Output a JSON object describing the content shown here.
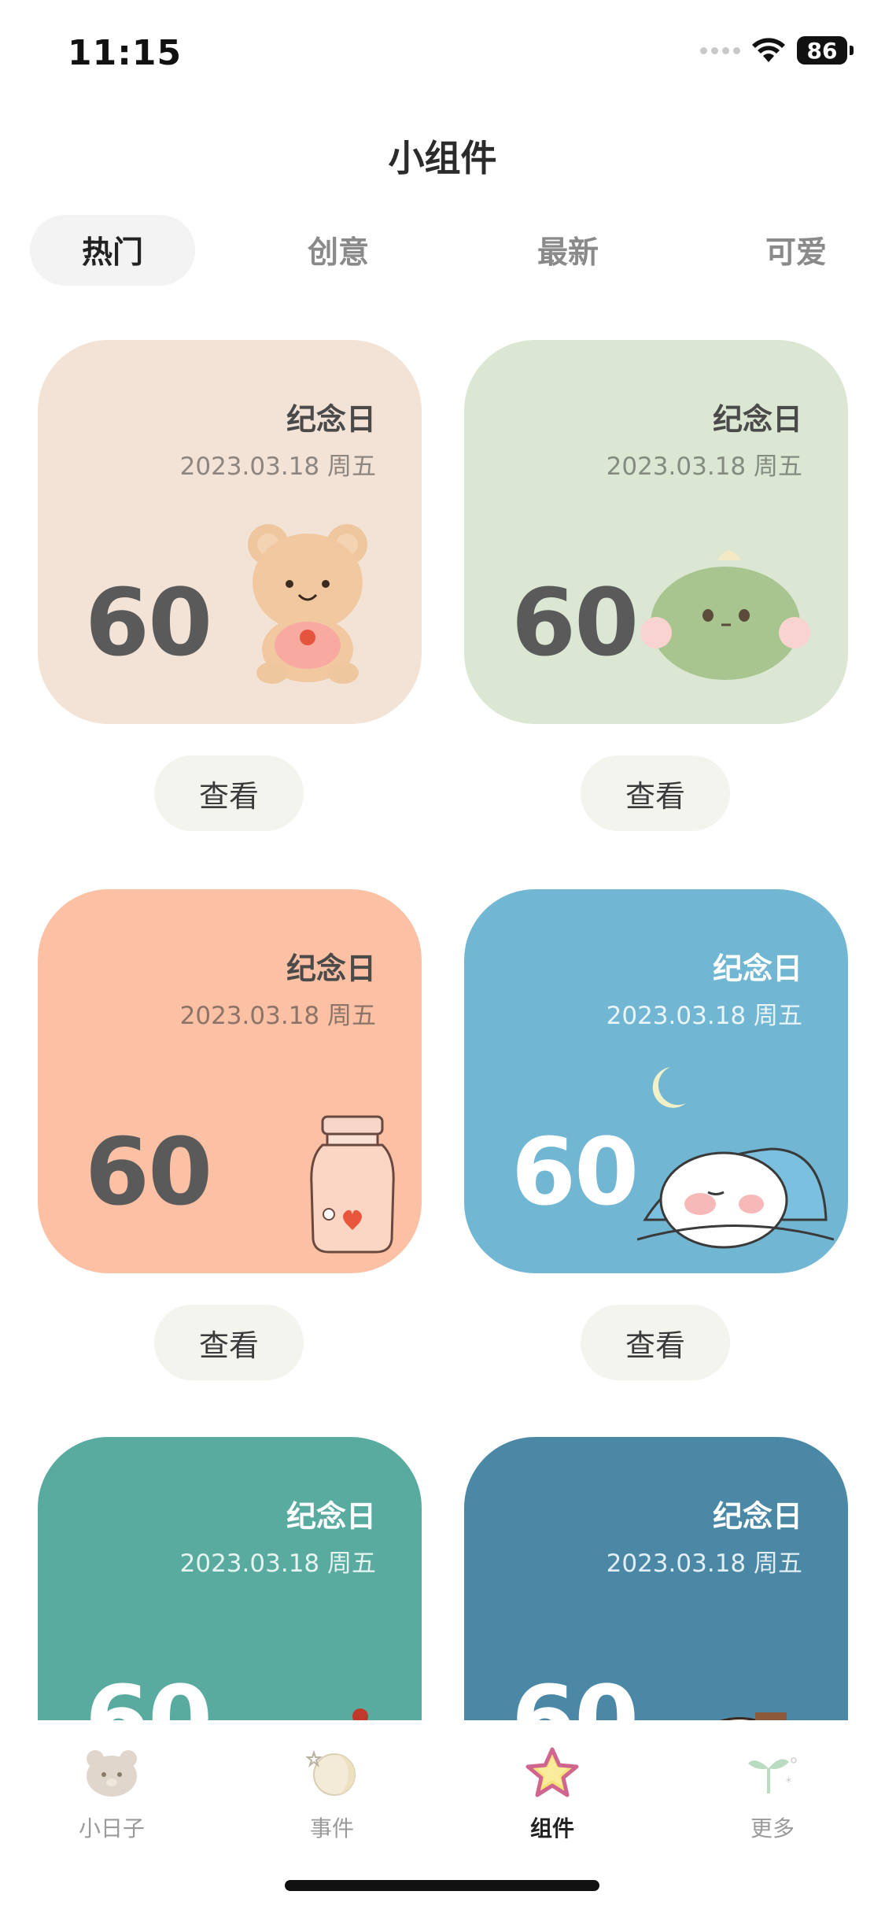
{
  "status_bar": {
    "time": "11:15",
    "battery": "86"
  },
  "page_title": "小组件",
  "tabs": [
    {
      "label": "热门",
      "active": true
    },
    {
      "label": "创意",
      "active": false
    },
    {
      "label": "最新",
      "active": false
    },
    {
      "label": "可爱",
      "active": false
    }
  ],
  "widgets": [
    {
      "title": "纪念日",
      "date": "2023.03.18 周五",
      "number": "60",
      "bg": "#f3e3d6",
      "text_color": "#4a4a4a",
      "date_color": "#8c8580",
      "number_color": "#5a5a5a",
      "illustration": "bear-icon",
      "button": "查看"
    },
    {
      "title": "纪念日",
      "date": "2023.03.18 周五",
      "number": "60",
      "bg": "#dbe7d2",
      "text_color": "#4a4a4a",
      "date_color": "#858b80",
      "number_color": "#5a5a5a",
      "illustration": "dinosaur-icon",
      "button": "查看"
    },
    {
      "title": "纪念日",
      "date": "2023.03.18 周五",
      "number": "60",
      "bg": "#fcc0a4",
      "text_color": "#4a4a4a",
      "date_color": "#8c7468",
      "number_color": "#5a5a5a",
      "illustration": "jar-icon",
      "button": "查看"
    },
    {
      "title": "纪念日",
      "date": "2023.03.18 周五",
      "number": "60",
      "bg": "#71b6d2",
      "text_color": "#ffffff",
      "date_color": "#eaf5fa",
      "number_color": "#ffffff",
      "illustration": "sleeping-cat-icon",
      "button": "查看"
    },
    {
      "title": "纪念日",
      "date": "2023.03.18 周五",
      "number": "60",
      "bg": "#5aab9f",
      "text_color": "#ffffff",
      "date_color": "#e6f4f1",
      "number_color": "#ffffff",
      "illustration": "bird-icon",
      "button": ""
    },
    {
      "title": "纪念日",
      "date": "2023.03.18 周五",
      "number": "60",
      "bg": "#4a88a5",
      "text_color": "#ffffff",
      "date_color": "#e3eff5",
      "number_color": "#ffffff",
      "illustration": "sleeping-animal-icon",
      "button": ""
    }
  ],
  "bottom_nav": [
    {
      "label": "小日子",
      "icon": "bear-face-icon",
      "active": false
    },
    {
      "label": "事件",
      "icon": "moon-icon",
      "active": false
    },
    {
      "label": "组件",
      "icon": "star-icon",
      "active": true
    },
    {
      "label": "更多",
      "icon": "sprout-icon",
      "active": false
    }
  ]
}
